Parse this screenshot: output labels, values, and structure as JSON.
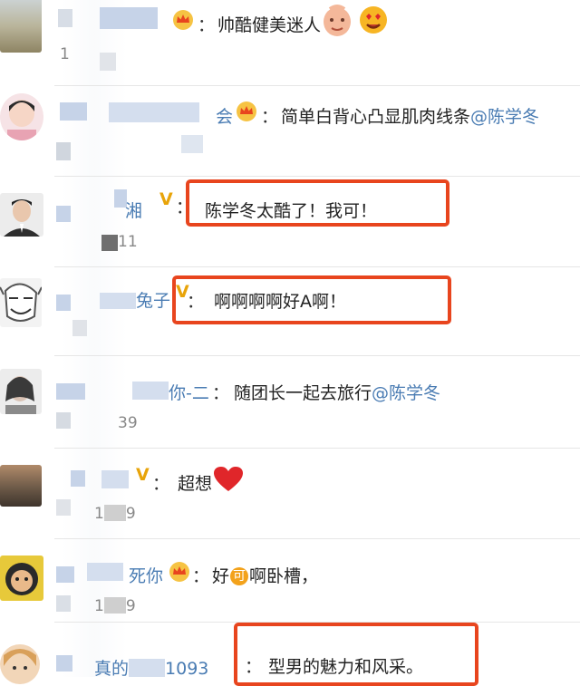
{
  "colors": {
    "link": "#4a7cb3",
    "highlight": "#e8451e",
    "badge_gold": "#e8a40a",
    "heart": "#e0262a"
  },
  "comments": [
    {
      "name": "",
      "text": "帅酷健美迷人",
      "likes": "1",
      "highlighted": false
    },
    {
      "name": "会",
      "text": "简单白背心凸显肌肉线条",
      "mention": "@陈学冬",
      "likes": "",
      "highlighted": false
    },
    {
      "name": "湘",
      "text": "陈学冬太酷了！我可！",
      "likes": "11",
      "highlighted": true
    },
    {
      "name": "兔子",
      "text": "啊啊啊啊好A啊！",
      "likes": "",
      "highlighted": true
    },
    {
      "name": "你-二",
      "text": "随团长一起去旅行",
      "mention": "@陈学冬",
      "likes": "39",
      "highlighted": false
    },
    {
      "name": "",
      "text": "超想",
      "likes": "1",
      "likes_tail": "9",
      "highlighted": false
    },
    {
      "name": "死你",
      "text_before": "好",
      "ke_badge": "可",
      "text_after": "啊卧槽，",
      "likes": "1",
      "likes_tail": "9",
      "highlighted": false
    },
    {
      "name": "真的",
      "name_tail": "1093",
      "text": "型男的魅力和风采。",
      "likes": "",
      "highlighted": true
    }
  ],
  "icons": [
    "crown-badge-icon",
    "v-badge-icon",
    "heart-icon",
    "baby-face-icon",
    "heart-eyes-icon"
  ]
}
